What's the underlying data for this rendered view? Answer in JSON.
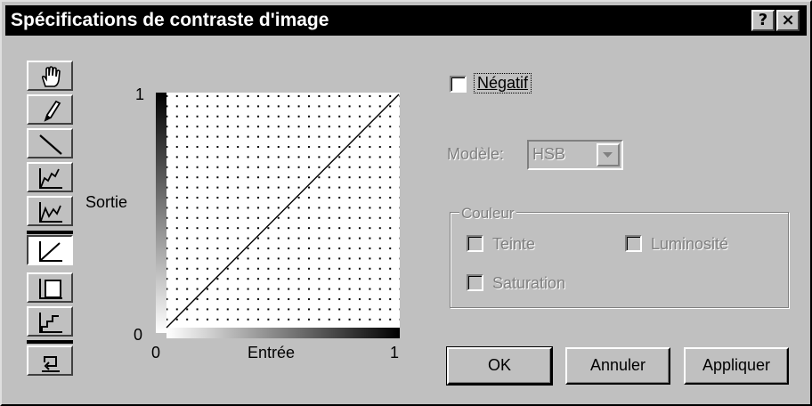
{
  "window": {
    "title": "Spécifications de contraste d'image",
    "help_glyph": "?",
    "close_glyph": "×"
  },
  "tools": [
    {
      "icon": "hand-icon"
    },
    {
      "icon": "pencil-icon"
    },
    {
      "icon": "line-icon"
    },
    {
      "icon": "curve-up-icon"
    },
    {
      "icon": "curve-down-icon"
    },
    {
      "icon": "linear-icon",
      "active": true
    },
    {
      "icon": "threshold-icon"
    },
    {
      "icon": "posterize-icon"
    },
    {
      "icon": "reset-icon"
    }
  ],
  "graph": {
    "ylabel": "Sortie",
    "xlabel": "Entrée",
    "y_max": "1",
    "y_min": "0",
    "x_min": "0",
    "x_max": "1"
  },
  "negatif": {
    "label": "Négatif",
    "checked": false
  },
  "modele": {
    "label": "Modèle:",
    "value": "HSB"
  },
  "couleur": {
    "legend": "Couleur",
    "teinte": "Teinte",
    "luminosite": "Luminosité",
    "saturation": "Saturation"
  },
  "buttons": {
    "ok": "OK",
    "annuler": "Annuler",
    "appliquer": "Appliquer"
  }
}
